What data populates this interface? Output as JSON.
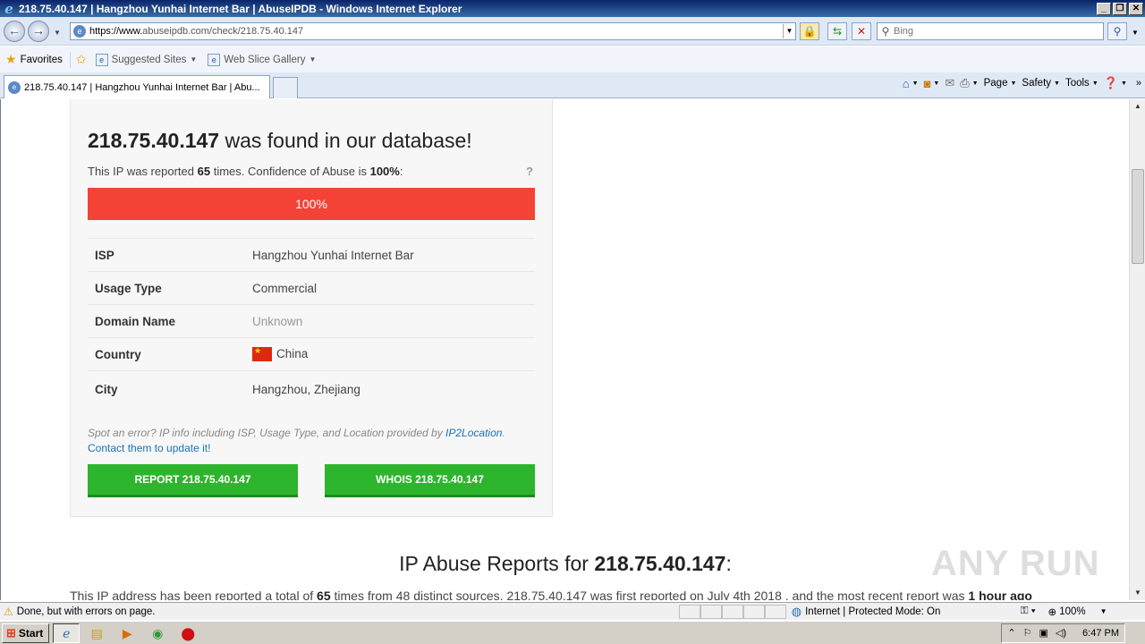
{
  "window": {
    "title": "218.75.40.147 | Hangzhou Yunhai Internet Bar | AbuseIPDB - Windows Internet Explorer"
  },
  "address": {
    "url_prefix": "https://www.",
    "url_rest": "abuseipdb.com/check/218.75.40.147"
  },
  "search": {
    "placeholder": "Bing"
  },
  "favorites": {
    "label": "Favorites",
    "items": [
      "Suggested Sites",
      "Web Slice Gallery"
    ]
  },
  "tab": {
    "label": "218.75.40.147 | Hangzhou Yunhai Internet Bar | Abu..."
  },
  "commandbar": {
    "page": "Page",
    "safety": "Safety",
    "tools": "Tools"
  },
  "page": {
    "ip": "218.75.40.147",
    "headline_suffix": "was found in our database!",
    "reported_prefix": "This IP was reported",
    "report_count": "65",
    "reported_mid": "times. Confidence of Abuse is",
    "confidence": "100%",
    "reported_suffix": ":",
    "help_mark": "?",
    "confidence_value": 1.0,
    "info": [
      {
        "key": "ISP",
        "value": "Hangzhou Yunhai Internet Bar"
      },
      {
        "key": "Usage Type",
        "value": "Commercial"
      },
      {
        "key": "Domain Name",
        "value": "Unknown"
      },
      {
        "key": "Country",
        "value": "China"
      },
      {
        "key": "City",
        "value": "Hangzhou, Zhejiang"
      }
    ],
    "note_text": "Spot an error? IP info including ISP, Usage Type, and Location provided by",
    "note_link": "IP2Location",
    "note_period": ".",
    "note_contact": "Contact them to update it!",
    "report_button": "REPORT 218.75.40.147",
    "whois_button": "WHOIS 218.75.40.147",
    "reports_title_prefix": "IP Abuse Reports for",
    "reports_title_suffix": ":",
    "summary_a": "This IP address has been reported a total of",
    "summary_count": "65",
    "summary_b": "times from 48 distinct sources. 218.75.40.147 was first reported on July 4th 2018 , and the most recent report was",
    "summary_recent": "1 hour ago",
    "watermark": "ANY RUN"
  },
  "status": {
    "text": "Done, but with errors on page.",
    "zone": "Internet | Protected Mode: On",
    "zoom": "100%"
  },
  "taskbar": {
    "start": "Start",
    "clock": "6:47 PM"
  },
  "colors": {
    "danger": "#f44336",
    "success": "#2db52d",
    "link": "#1a73b5"
  }
}
